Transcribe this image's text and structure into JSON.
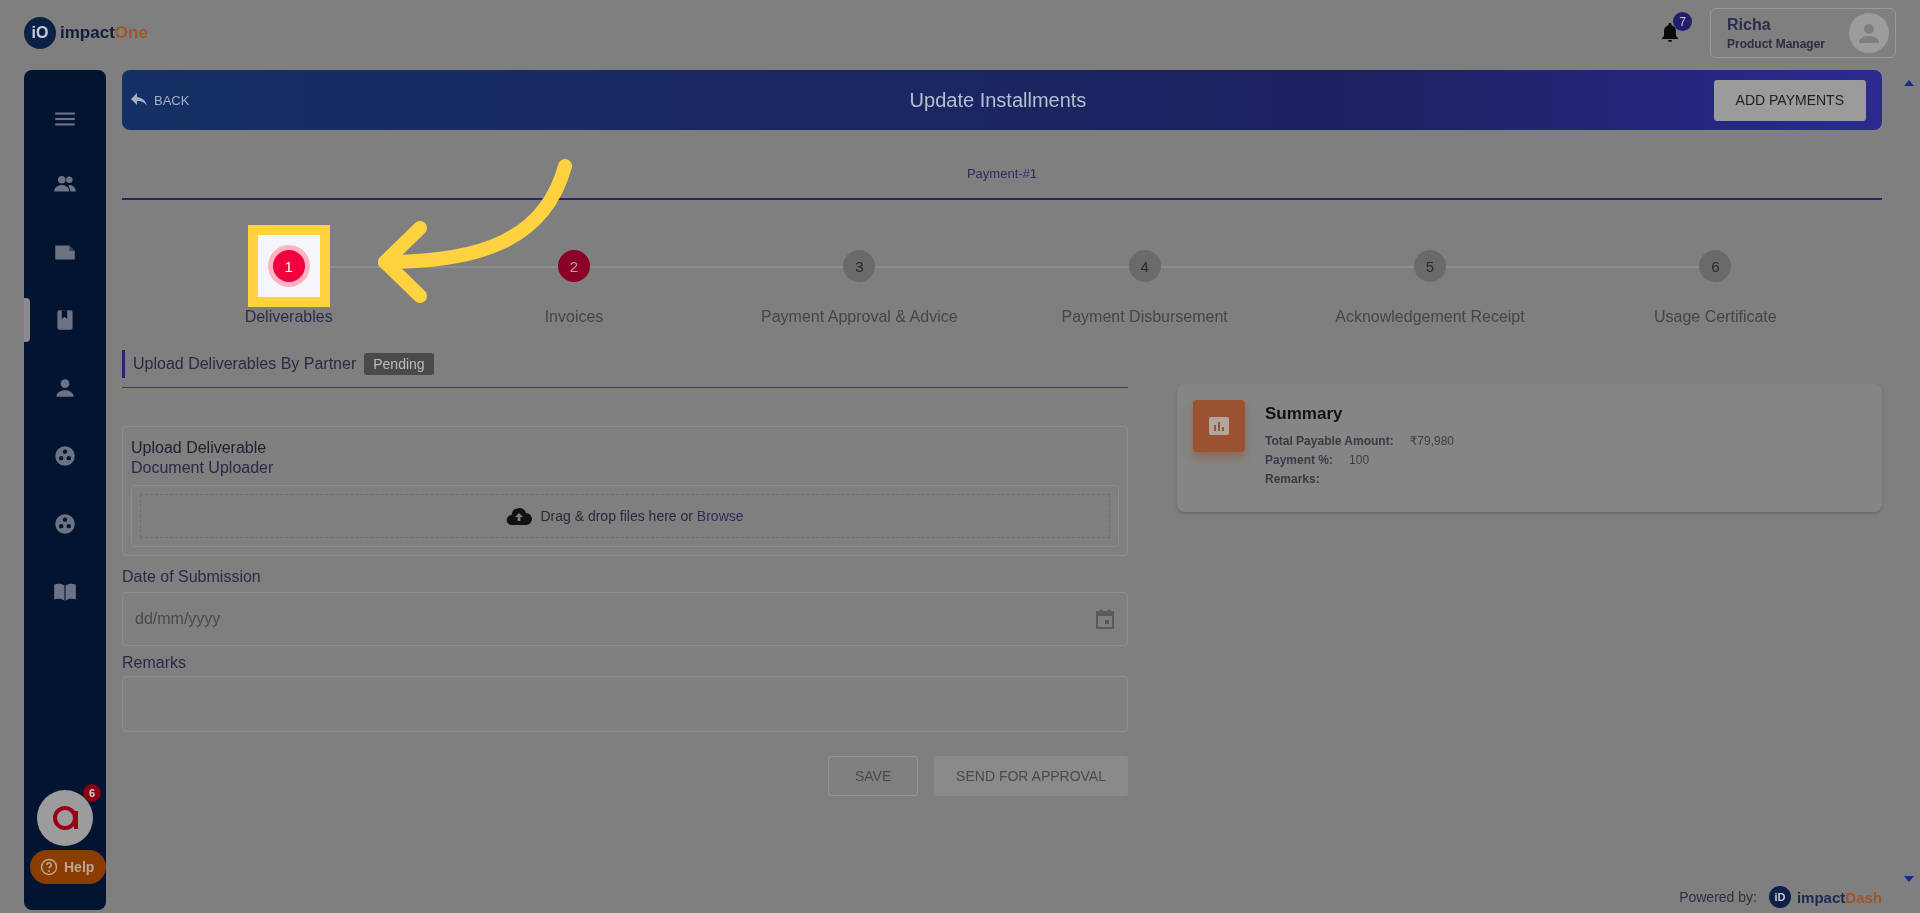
{
  "header": {
    "logo": {
      "mark": "iO",
      "word": "impact",
      "accent": "One"
    },
    "notifications": {
      "count": "7"
    },
    "user": {
      "name": "Richa",
      "role": "Product Manager"
    }
  },
  "sidebar": {
    "items": [
      {
        "kind": "menu",
        "selected": false
      },
      {
        "kind": "people",
        "selected": false
      },
      {
        "kind": "folder",
        "selected": false
      },
      {
        "kind": "book",
        "selected": true
      },
      {
        "kind": "person",
        "selected": false
      },
      {
        "kind": "group",
        "selected": false
      },
      {
        "kind": "group",
        "selected": false
      },
      {
        "kind": "manual",
        "selected": false
      }
    ],
    "chat": {
      "badge": "6"
    },
    "help": {
      "label": "Help"
    }
  },
  "banner": {
    "back": "BACK",
    "title": "Update Installments",
    "action": "ADD PAYMENTS"
  },
  "payment_tab": {
    "label": "Payment-#1"
  },
  "steps": [
    {
      "number": "1",
      "label": "Deliverables",
      "active": true,
      "completed": false,
      "spotlight": true
    },
    {
      "number": "2",
      "label": "Invoices",
      "active": false,
      "completed": true,
      "spotlight": false
    },
    {
      "number": "3",
      "label": "Payment Approval & Advice",
      "active": false,
      "completed": false,
      "spotlight": false
    },
    {
      "number": "4",
      "label": "Payment Disbursement",
      "active": false,
      "completed": false,
      "spotlight": false
    },
    {
      "number": "5",
      "label": "Acknowledgement Receipt",
      "active": false,
      "completed": false,
      "spotlight": false
    },
    {
      "number": "6",
      "label": "Usage Certificate",
      "active": false,
      "completed": false,
      "spotlight": false
    }
  ],
  "section": {
    "title": "Upload Deliverables By Partner",
    "badge": "Pending"
  },
  "upload": {
    "title": "Upload Deliverable",
    "subtitle": "Document Uploader",
    "prompt": "Drag & drop files here or",
    "link": "Browse"
  },
  "date_field": {
    "label": "Date of Submission",
    "placeholder": "dd/mm/yyyy"
  },
  "remarks_field": {
    "label": "Remarks"
  },
  "buttons": [
    {
      "label": "SAVE",
      "kind": "outlined",
      "disabled": true
    },
    {
      "label": "SEND FOR APPROVAL",
      "kind": "filled",
      "disabled": true
    }
  ],
  "summary": {
    "title": "Summary",
    "rows": [
      {
        "label": "Total Payable Amount:",
        "value": "₹79,980"
      },
      {
        "label": "Payment %:",
        "value": "100"
      },
      {
        "label": "Remarks:"
      }
    ]
  },
  "footer": {
    "prefix": "Powered by:",
    "logo": {
      "mark": "iD",
      "word": "impact",
      "accent": "Dash"
    }
  }
}
